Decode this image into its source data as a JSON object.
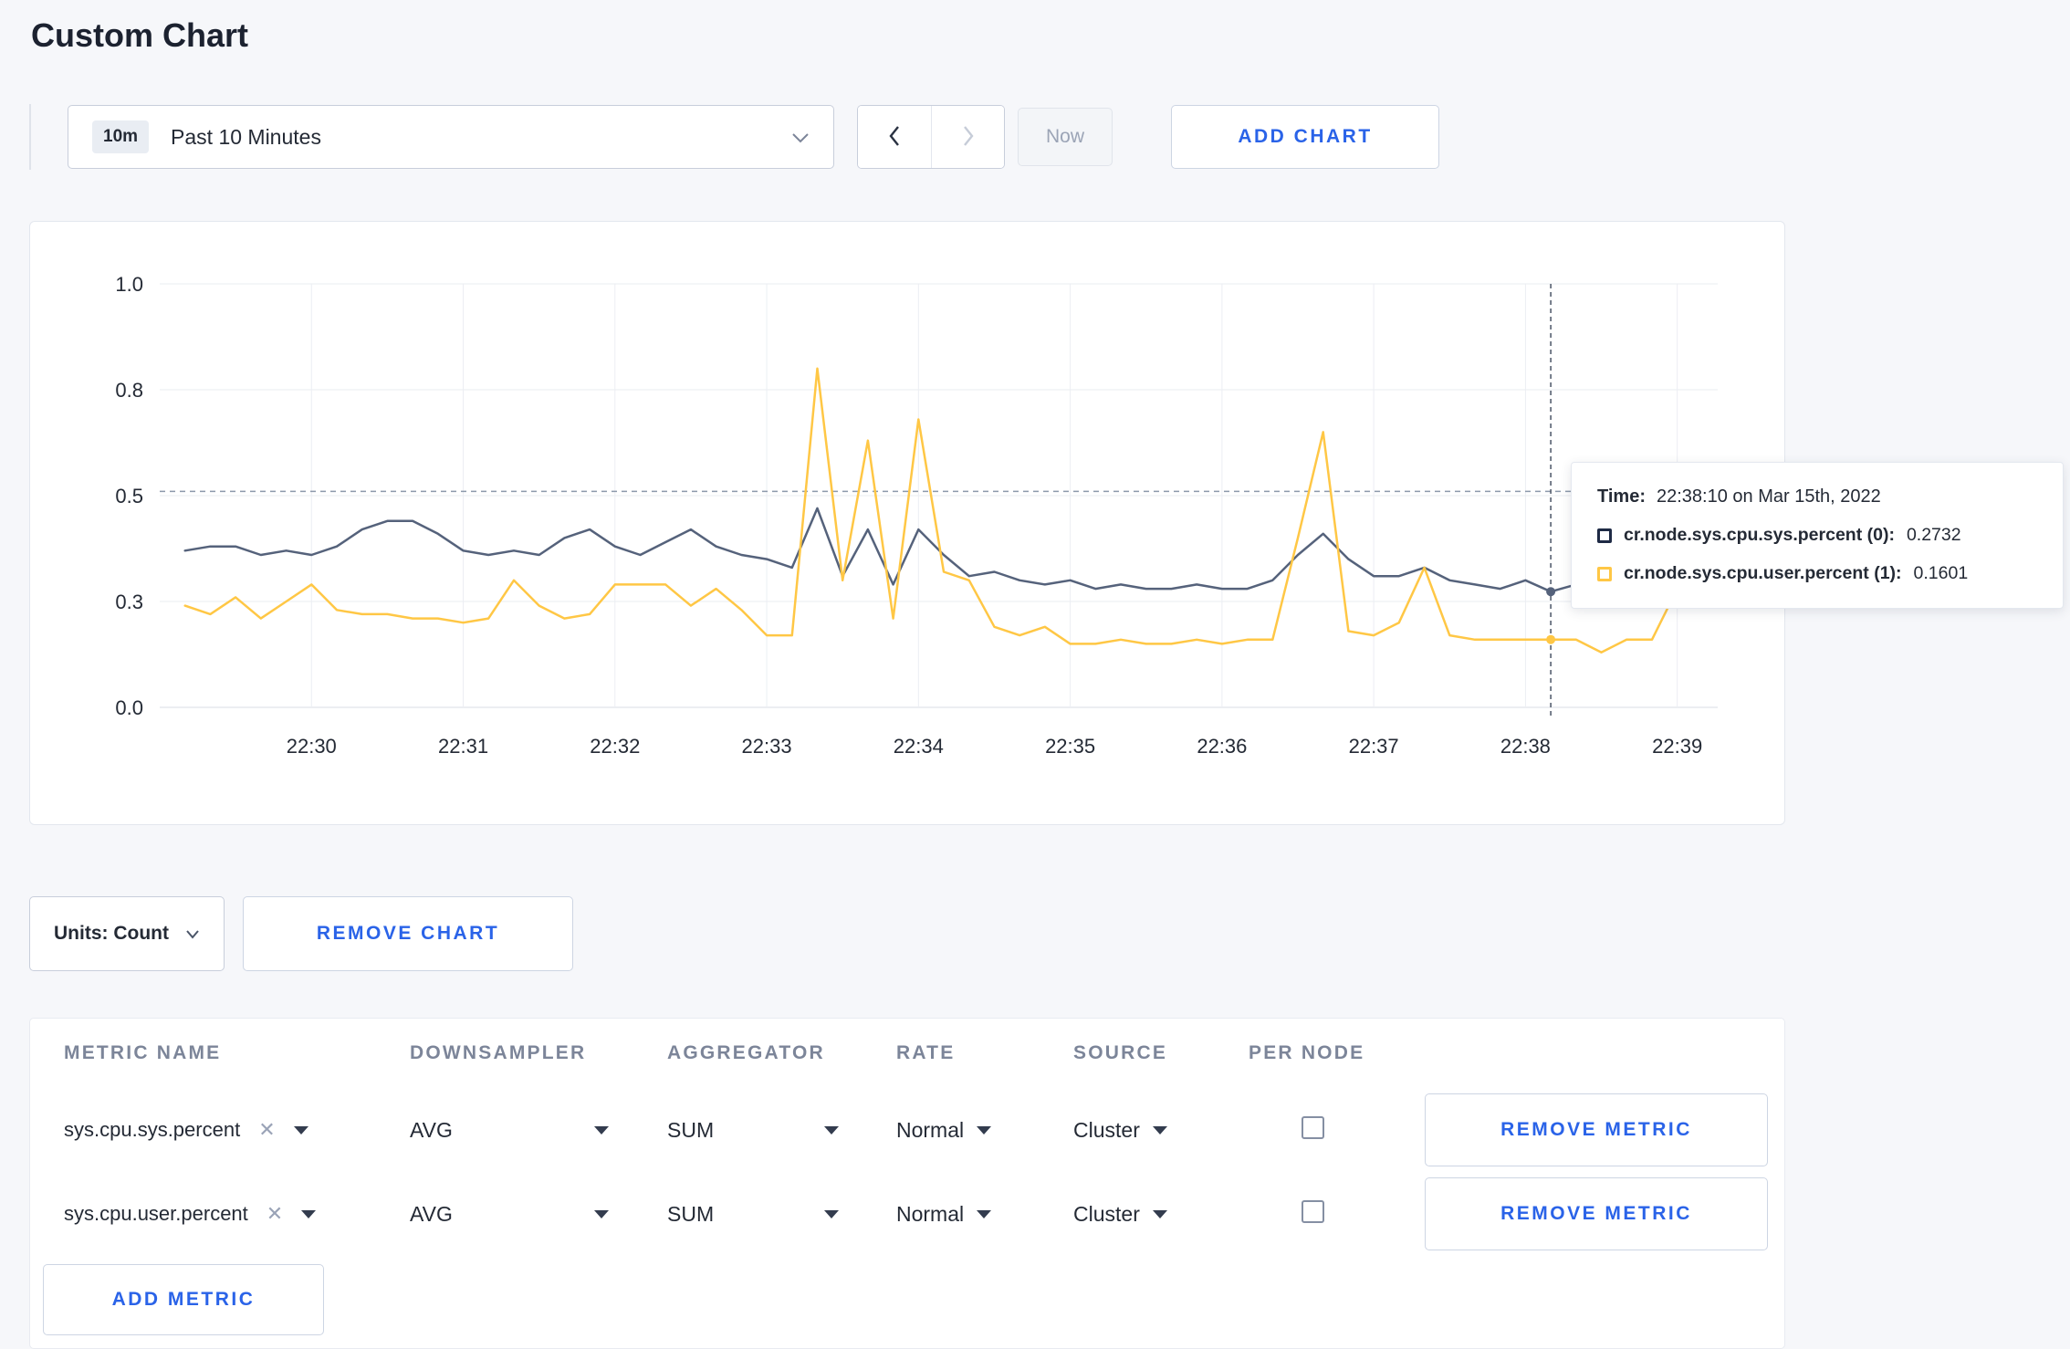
{
  "page": {
    "title": "Custom Chart"
  },
  "toolbar": {
    "time_window": {
      "badge": "10m",
      "label": "Past 10 Minutes"
    },
    "now_label": "Now",
    "add_chart_label": "ADD CHART"
  },
  "chart_controls": {
    "units_label": "Units: Count",
    "remove_chart_label": "REMOVE CHART",
    "remove_metric_label": "REMOVE METRIC",
    "add_metric_label": "ADD METRIC"
  },
  "tooltip": {
    "time_label": "Time:",
    "time_value": "22:38:10 on Mar 15th, 2022",
    "series": [
      {
        "name": "cr.node.sys.cpu.sys.percent (0):",
        "value": "0.2732",
        "color": "#1e2a45"
      },
      {
        "name": "cr.node.sys.cpu.user.percent (1):",
        "value": "0.1601",
        "color": "#ffc745"
      }
    ]
  },
  "table": {
    "headers": [
      "METRIC NAME",
      "DOWNSAMPLER",
      "AGGREGATOR",
      "RATE",
      "SOURCE",
      "PER NODE"
    ],
    "rows": [
      {
        "metric": "sys.cpu.sys.percent",
        "downsampler": "AVG",
        "aggregator": "SUM",
        "rate": "Normal",
        "source": "Cluster",
        "per_node": false
      },
      {
        "metric": "sys.cpu.user.percent",
        "downsampler": "AVG",
        "aggregator": "SUM",
        "rate": "Normal",
        "source": "Cluster",
        "per_node": false
      }
    ]
  },
  "chart_data": {
    "type": "line",
    "title": "",
    "xlabel": "",
    "ylabel": "",
    "ylim": [
      0,
      1
    ],
    "grid": true,
    "x_start_time": "22:29:10",
    "x_interval_seconds": 10,
    "xlim_offsets": [
      -10,
      606
    ],
    "x_ticks": [
      {
        "label": "22:30",
        "offset": 50
      },
      {
        "label": "22:31",
        "offset": 110
      },
      {
        "label": "22:32",
        "offset": 170
      },
      {
        "label": "22:33",
        "offset": 230
      },
      {
        "label": "22:34",
        "offset": 290
      },
      {
        "label": "22:35",
        "offset": 350
      },
      {
        "label": "22:36",
        "offset": 410
      },
      {
        "label": "22:37",
        "offset": 470
      },
      {
        "label": "22:38",
        "offset": 530
      },
      {
        "label": "22:39",
        "offset": 590
      }
    ],
    "y_ticks": [
      {
        "label": "0.0",
        "value": 0
      },
      {
        "label": "0.3",
        "value": 0.25
      },
      {
        "label": "0.5",
        "value": 0.5
      },
      {
        "label": "0.8",
        "value": 0.75
      },
      {
        "label": "1.0",
        "value": 1
      }
    ],
    "hline_value": 0.51,
    "crosshair": {
      "offset": 540,
      "time": "22:38:10"
    },
    "series": [
      {
        "name": "cr.node.sys.cpu.sys.percent",
        "color": "#55627b",
        "marker_value": 0.2732,
        "values": [
          0.37,
          0.38,
          0.38,
          0.36,
          0.37,
          0.36,
          0.38,
          0.42,
          0.44,
          0.44,
          0.41,
          0.37,
          0.36,
          0.37,
          0.36,
          0.4,
          0.42,
          0.38,
          0.36,
          0.39,
          0.42,
          0.38,
          0.36,
          0.35,
          0.33,
          0.47,
          0.31,
          0.42,
          0.29,
          0.42,
          0.36,
          0.31,
          0.32,
          0.3,
          0.29,
          0.3,
          0.28,
          0.29,
          0.28,
          0.28,
          0.29,
          0.28,
          0.28,
          0.3,
          0.36,
          0.41,
          0.35,
          0.31,
          0.31,
          0.33,
          0.3,
          0.29,
          0.28,
          0.3,
          0.2732,
          0.29,
          0.32,
          0.3,
          0.3,
          0.31,
          0.31
        ]
      },
      {
        "name": "cr.node.sys.cpu.user.percent",
        "color": "#ffc745",
        "marker_value": 0.1601,
        "values": [
          0.24,
          0.22,
          0.26,
          0.21,
          0.25,
          0.29,
          0.23,
          0.22,
          0.22,
          0.21,
          0.21,
          0.2,
          0.21,
          0.3,
          0.24,
          0.21,
          0.22,
          0.29,
          0.29,
          0.29,
          0.24,
          0.28,
          0.23,
          0.17,
          0.17,
          0.8,
          0.3,
          0.63,
          0.21,
          0.68,
          0.32,
          0.3,
          0.19,
          0.17,
          0.19,
          0.15,
          0.15,
          0.16,
          0.15,
          0.15,
          0.16,
          0.15,
          0.16,
          0.16,
          0.4,
          0.65,
          0.18,
          0.17,
          0.2,
          0.33,
          0.17,
          0.16,
          0.16,
          0.16,
          0.1601,
          0.16,
          0.13,
          0.16,
          0.16,
          0.28,
          0.24
        ]
      }
    ]
  }
}
